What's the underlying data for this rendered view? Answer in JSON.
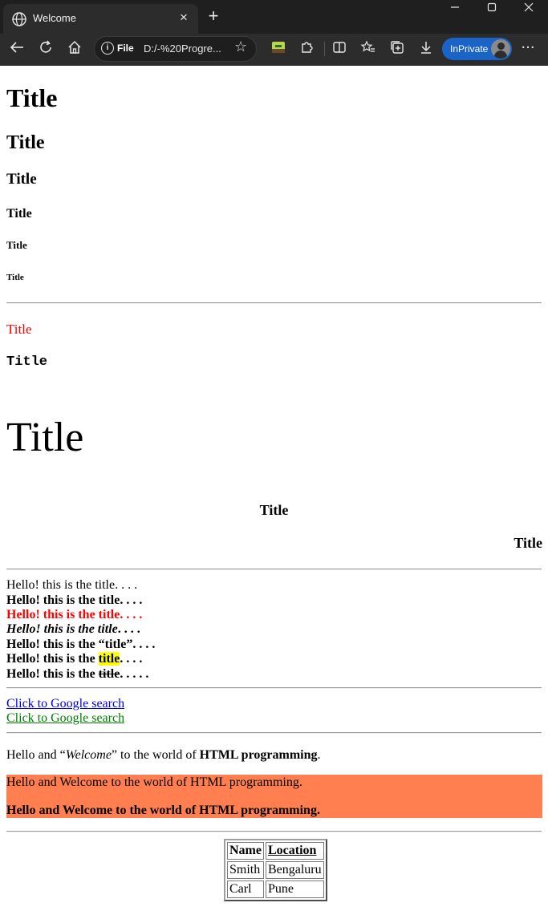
{
  "browser": {
    "tab_title": "Welcome",
    "tab_close": "×",
    "new_tab": "+",
    "address_scheme": "File",
    "address_url": "D:/-%20Progre...",
    "inprivate_label": "InPrivate",
    "more_label": "···"
  },
  "page": {
    "h1": "Title",
    "h2": "Title",
    "h3": "Title",
    "h4": "Title",
    "h5": "Title",
    "h6": "Title",
    "red_title": "Title",
    "mono_title": "Title",
    "big_title": "Title",
    "center_title": "Title",
    "right_title": "Title",
    "lines": {
      "plain": "Hello! this is the title. . . .",
      "bold": "Hello! this is the title. . . .",
      "red": "Hello! this is the title. . . .",
      "italic_a": "Hello! this is the title",
      "italic_b": ". . . .",
      "quoted": "Hello! this is the “title”. . . .",
      "mark_a": "Hello! this is the ",
      "mark_b": "title",
      "mark_c": ". . . .",
      "strike_a": "Hello! this is the ",
      "strike_b": "title",
      "strike_c": ". . . . ."
    },
    "links": {
      "link1": "Click to Google search",
      "link2": "Click to Google search"
    },
    "para": {
      "a": "Hello and “",
      "b": "Welcome",
      "c": "” to the world of ",
      "d": "HTML programming",
      "e": "."
    },
    "banner": {
      "line1": "Hello and Welcome to the world of HTML programming.",
      "line2": "Hello and Welcome to the world of HTML programming."
    },
    "table": {
      "headers": [
        "Name",
        "Location"
      ],
      "rows": [
        [
          "Smith",
          "Bengaluru"
        ],
        [
          "Carl",
          "Pune"
        ]
      ]
    }
  },
  "colors": {
    "red_text": "#ff0000",
    "link_blue": "#0000ee",
    "link_green": "#008000",
    "highlight": "#ffff00",
    "banner_bg": "#ff7f50",
    "inprivate_pill": "#1a64c8"
  }
}
